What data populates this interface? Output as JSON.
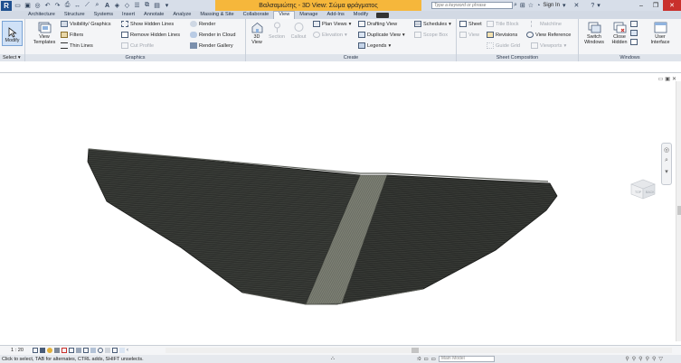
{
  "titlebar": {
    "logo": "R",
    "title": "Βαλσαμιώτης - 3D View: Σώμα φράγματος",
    "search_placeholder": "Type a keyword or phrase",
    "sign_in": "Sign In",
    "help": "?",
    "accent_color": "#f6b73b"
  },
  "tabs": [
    {
      "label": "Architecture"
    },
    {
      "label": "Structure"
    },
    {
      "label": "Systems"
    },
    {
      "label": "Insert"
    },
    {
      "label": "Annotate"
    },
    {
      "label": "Analyze"
    },
    {
      "label": "Massing & Site"
    },
    {
      "label": "Collaborate"
    },
    {
      "label": "View"
    },
    {
      "label": "Manage"
    },
    {
      "label": "Add-Ins"
    },
    {
      "label": "Modify"
    }
  ],
  "active_tab": "View",
  "ribbon": {
    "select": {
      "modify": "Modify",
      "panel_label": "Select"
    },
    "graphics": {
      "view_templates": [
        "View",
        "Templates"
      ],
      "visibility": "Visibility/ Graphics",
      "filters": "Filters",
      "thin_lines": "Thin Lines",
      "show_hidden": "Show Hidden Lines",
      "remove_hidden": "Remove Hidden Lines",
      "cut_profile": "Cut Profile",
      "render": "Render",
      "render_cloud": "Render in Cloud",
      "render_gallery": "Render Gallery",
      "panel_label": "Graphics"
    },
    "create": {
      "view_3d": [
        "3D",
        "View"
      ],
      "section": "Section",
      "callout": "Callout",
      "plan_views": "Plan Views",
      "elevation": "Elevation",
      "drafting_view": "Drafting View",
      "duplicate_view": "Duplicate View",
      "legends": "Legends",
      "schedules": "Schedules",
      "scope_box": "Scope Box",
      "panel_label": "Create"
    },
    "sheet": {
      "sheet": "Sheet",
      "title_block": "Title Block",
      "matchline": "Matchline",
      "view": "View",
      "revisions": "Revisions",
      "view_reference": "View Reference",
      "guide_grid": "Guide Grid",
      "viewports": "Viewports",
      "panel_label": "Sheet Composition"
    },
    "windows": {
      "switch_windows": [
        "Switch",
        "Windows"
      ],
      "close_hidden": [
        "Close",
        "Hidden"
      ],
      "user_interface": [
        "User",
        "Interface"
      ],
      "panel_label": "Windows"
    }
  },
  "view": {
    "scale": "1 : 20",
    "model_dropdown": "Main Model",
    "viewcube_faces": [
      "TOP",
      "BACK"
    ]
  },
  "status": {
    "text": "Click to select, TAB for alternates, CTRL adds, SHIFT unselects.",
    "zero": ":0"
  }
}
